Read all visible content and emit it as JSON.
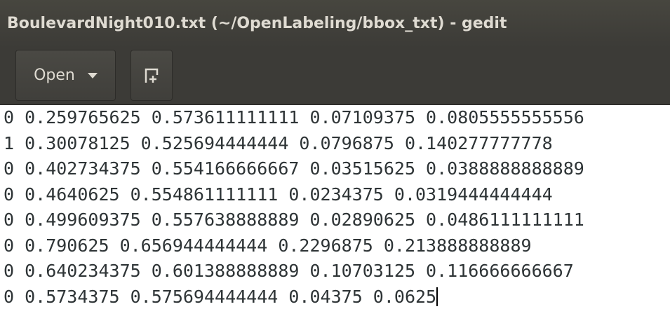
{
  "window": {
    "title": "BoulevardNight010.txt (~/OpenLabeling/bbox_txt) - gedit"
  },
  "toolbar": {
    "open_label": "Open",
    "open_dropdown_icon": "chevron-down-icon",
    "new_document_icon": "new-document-icon"
  },
  "colors": {
    "titlebar_bg": "#3c3b37",
    "titlebar_text": "#dfdbd2",
    "editor_bg": "#ffffff",
    "editor_text": "#2e3436"
  },
  "editor": {
    "lines": [
      "0 0.259765625 0.573611111111 0.07109375 0.0805555555556",
      "1 0.30078125 0.525694444444 0.0796875 0.140277777778",
      "0 0.402734375 0.554166666667 0.03515625 0.0388888888889",
      "0 0.4640625 0.554861111111 0.0234375 0.0319444444444",
      "0 0.499609375 0.557638888889 0.02890625 0.0486111111111",
      "0 0.790625 0.656944444444 0.2296875 0.213888888889",
      "0 0.640234375 0.601388888889 0.10703125 0.116666666667",
      "0 0.5734375 0.575694444444 0.04375 0.0625"
    ]
  }
}
